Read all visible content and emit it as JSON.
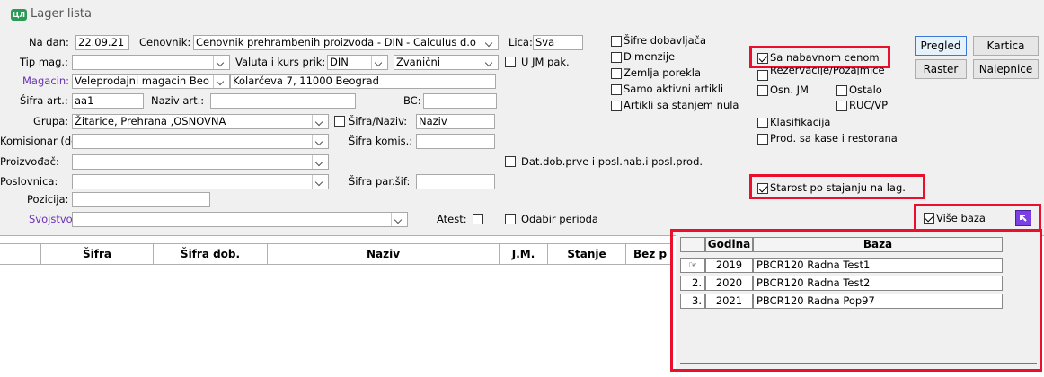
{
  "window": {
    "title": "Lager lista",
    "icon": "app-logo-icon"
  },
  "form": {
    "na_dan": {
      "label": "Na dan:",
      "value": "22.09.21"
    },
    "cenovnik": {
      "label": "Cenovnik:",
      "value": "Cenovnik prehrambenih proizvoda - DIN - Calculus d.o"
    },
    "lica": {
      "label": "Lica:",
      "value": "Sva"
    },
    "tip_mag": {
      "label": "Tip mag.:",
      "value": ""
    },
    "valuta": {
      "label": "Valuta i kurs prik:",
      "value": "DIN",
      "kurs": "Zvanični"
    },
    "u_jm_pak": {
      "label": "U JM pak."
    },
    "magacin": {
      "label": "Magacin:",
      "value": "Veleprodajni magacin Beo",
      "adresa": "Kolarčeva 7, 11000 Beograd"
    },
    "sifra_art": {
      "label": "Šifra art.:",
      "value": "aa1"
    },
    "naziv_art": {
      "label": "Naziv art.:",
      "value": ""
    },
    "bc": {
      "label": "BC:",
      "value": ""
    },
    "grupa": {
      "label": "Grupa:",
      "value": "Žitarice, Prehrana ,OSNOVNA"
    },
    "sifra_naziv": {
      "label": "Šifra/Naziv:",
      "value": "Naziv"
    },
    "komisionar": {
      "label": "Komisionar (dob.):",
      "value": ""
    },
    "sifra_komis": {
      "label": "Šifra komis.:",
      "value": ""
    },
    "proizvodjac": {
      "label": "Proizvođač:",
      "value": ""
    },
    "dat_dob": {
      "label": "Dat.dob.prve i posl.nab.i posl.prod."
    },
    "poslovnica": {
      "label": "Poslovnica:",
      "value": ""
    },
    "sifra_par": {
      "label": "Šifra par.šif:",
      "value": ""
    },
    "pozicija": {
      "label": "Pozicija:",
      "value": ""
    },
    "svojstvo": {
      "label": "Svojstvo:",
      "value": ""
    },
    "atest": {
      "label": "Atest:"
    },
    "odabir_perioda": {
      "label": "Odabir perioda"
    }
  },
  "options": {
    "sifre_dobavljaca": "Šifre dobavljača",
    "dimenzije": "Dimenzije",
    "zemlja_porekla": "Zemlja porekla",
    "samo_aktivni": "Samo aktivni artikli",
    "artikli_nula": "Artikli sa stanjem nula",
    "sa_nabavnom": "Sa nabavnom cenom",
    "rezervacije": "Rezervacije/Pozajmice",
    "osn_jm": "Osn. JM",
    "ostalo": "Ostalo",
    "ruc_vp": "RUC/VP",
    "klasifikacija": "Klasifikacija",
    "prod_kase": "Prod. sa kase i restorana",
    "starost": "Starost po stajanju na lag.",
    "vise_baza": "Više baza"
  },
  "buttons": {
    "pregled": "Pregled",
    "kartica": "Kartica",
    "raster": "Raster",
    "nalepnice": "Nalepnice"
  },
  "grid": {
    "columns": [
      "Šifra",
      "Šifra dob.",
      "Naziv",
      "J.M.",
      "Stanje",
      "Bez p"
    ]
  },
  "bases": {
    "headers": [
      "Godina",
      "Baza"
    ],
    "rows": [
      {
        "num": "",
        "godina": "2019",
        "baza": "PBCR120 Radna Test1"
      },
      {
        "num": "2.",
        "godina": "2020",
        "baza": "PBCR120 Radna Test2"
      },
      {
        "num": "3.",
        "godina": "2021",
        "baza": "PBCR120 Radna Pop97"
      }
    ]
  },
  "colors": {
    "highlight": "#e8112d",
    "purple_label": "#6b2fb5",
    "accent_button": "#7b3fe4"
  }
}
